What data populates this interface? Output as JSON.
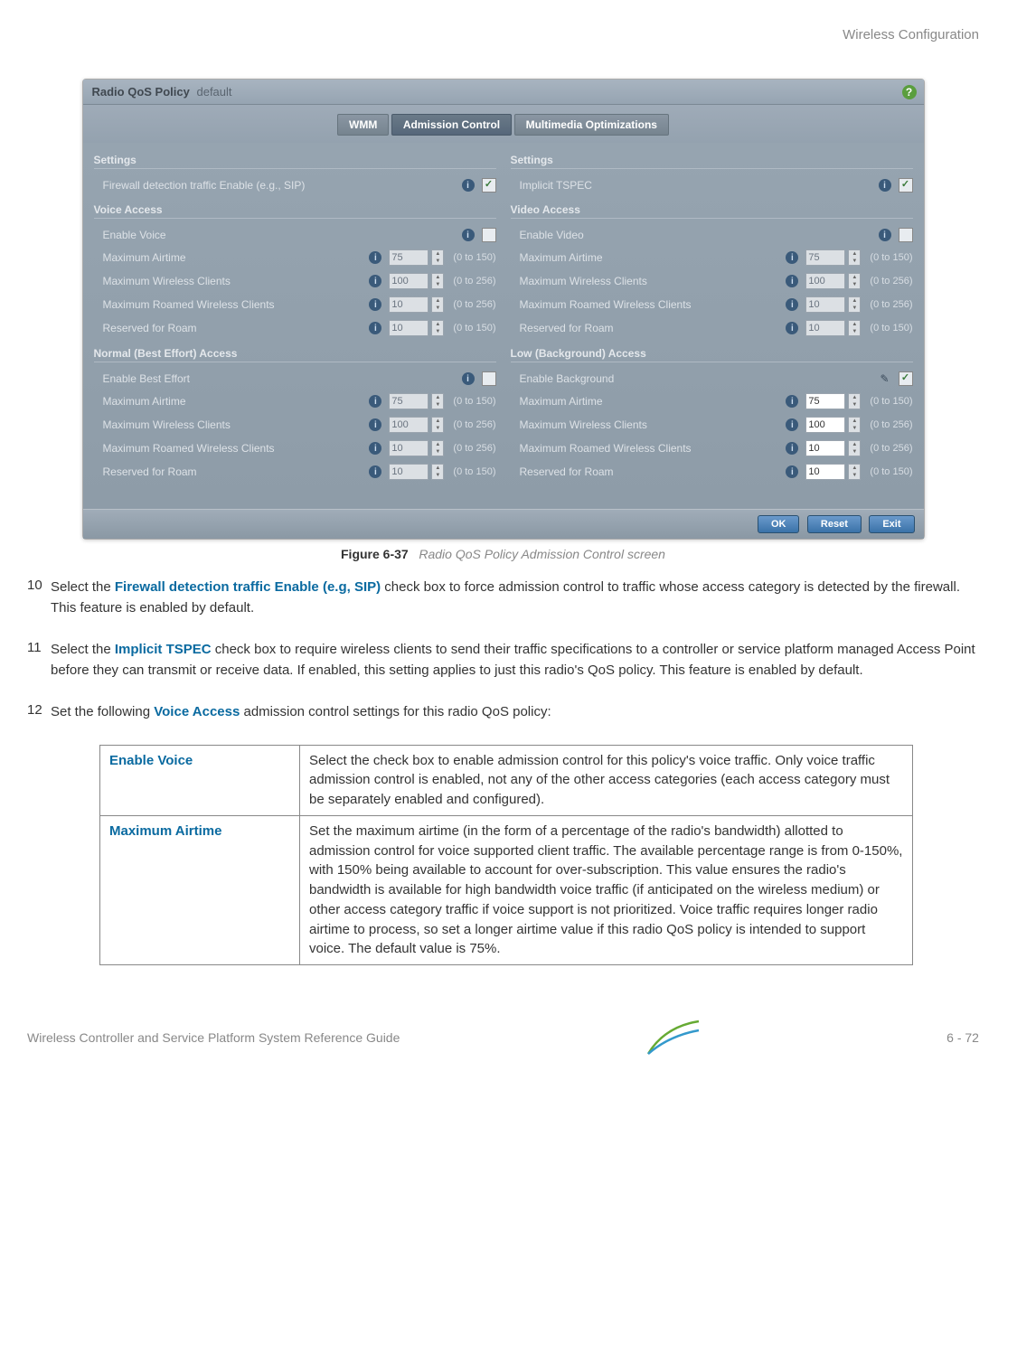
{
  "header_right": "Wireless Configuration",
  "screenshot": {
    "title_prefix": "Radio QoS Policy",
    "title_suffix": "default",
    "help": "?",
    "tabs": {
      "wmm": "WMM",
      "admission": "Admission Control",
      "multimedia": "Multimedia Optimizations"
    },
    "left": {
      "settings_title": "Settings",
      "firewall_label": "Firewall detection traffic Enable (e.g., SIP)",
      "firewall_checked": "✓",
      "voice_title": "Voice Access",
      "voice": {
        "enable_label": "Enable Voice",
        "airtime_label": "Maximum Airtime",
        "airtime_val": "75",
        "airtime_range": "(0 to 150)",
        "clients_label": "Maximum Wireless Clients",
        "clients_val": "100",
        "clients_range": "(0 to 256)",
        "roamed_label": "Maximum Roamed Wireless Clients",
        "roamed_val": "10",
        "roamed_range": "(0 to 256)",
        "reserved_label": "Reserved for Roam",
        "reserved_val": "10",
        "reserved_range": "(0 to 150)"
      },
      "be_title": "Normal (Best Effort) Access",
      "be": {
        "enable_label": "Enable Best Effort",
        "airtime_label": "Maximum Airtime",
        "airtime_val": "75",
        "airtime_range": "(0 to 150)",
        "clients_label": "Maximum Wireless Clients",
        "clients_val": "100",
        "clients_range": "(0 to 256)",
        "roamed_label": "Maximum Roamed Wireless Clients",
        "roamed_val": "10",
        "roamed_range": "(0 to 256)",
        "reserved_label": "Reserved for Roam",
        "reserved_val": "10",
        "reserved_range": "(0 to 150)"
      }
    },
    "right": {
      "settings_title": "Settings",
      "tspec_label": "Implicit TSPEC",
      "tspec_checked": "✓",
      "video_title": "Video Access",
      "video": {
        "enable_label": "Enable Video",
        "airtime_label": "Maximum Airtime",
        "airtime_val": "75",
        "airtime_range": "(0 to 150)",
        "clients_label": "Maximum Wireless Clients",
        "clients_val": "100",
        "clients_range": "(0 to 256)",
        "roamed_label": "Maximum Roamed Wireless Clients",
        "roamed_val": "10",
        "roamed_range": "(0 to 256)",
        "reserved_label": "Reserved for Roam",
        "reserved_val": "10",
        "reserved_range": "(0 to 150)"
      },
      "bg_title": "Low (Background) Access",
      "bg": {
        "enable_label": "Enable Background",
        "enable_checked": "✓",
        "airtime_label": "Maximum Airtime",
        "airtime_val": "75",
        "airtime_range": "(0 to 150)",
        "clients_label": "Maximum Wireless Clients",
        "clients_val": "100",
        "clients_range": "(0 to 256)",
        "roamed_label": "Maximum Roamed Wireless Clients",
        "roamed_val": "10",
        "roamed_range": "(0 to 256)",
        "reserved_label": "Reserved for Roam",
        "reserved_val": "10",
        "reserved_range": "(0 to 150)"
      }
    },
    "buttons": {
      "ok": "OK",
      "reset": "Reset",
      "exit": "Exit"
    }
  },
  "caption_bold": "Figure 6-37",
  "caption_rest": "Radio QoS Policy Admission Control screen",
  "step10": {
    "num": "10",
    "pre": "Select the ",
    "hl": "Firewall detection traffic Enable (e.g, SIP)",
    "post": " check box to force admission control to traffic whose access category is detected by the firewall. This feature is enabled by default."
  },
  "step11": {
    "num": "11",
    "pre": "Select the ",
    "hl": "Implicit TSPEC",
    "post": " check box to require wireless clients to send their traffic specifications to a controller or service platform managed Access Point before they can transmit or receive data. If enabled, this setting applies to just this radio's QoS policy. This feature is enabled by default."
  },
  "step12": {
    "num": "12",
    "pre": "Set the following ",
    "hl": "Voice Access",
    "post": " admission control settings for this radio QoS policy:"
  },
  "table": {
    "row1_label": "Enable Voice",
    "row1_desc": "Select the check box to enable admission control for this policy's voice traffic. Only voice traffic admission control is enabled, not any of the other access categories (each access category must be separately enabled and configured).",
    "row2_label": "Maximum Airtime",
    "row2_desc": "Set the maximum airtime (in the form of a percentage of the radio's bandwidth) allotted to admission control for voice supported client traffic. The available percentage range is from 0-150%, with 150% being available to account for over-subscription. This value ensures the radio's bandwidth is available for high bandwidth voice traffic (if anticipated on the wireless medium) or other access category traffic if voice support is not prioritized. Voice traffic requires longer radio airtime to process, so set a longer airtime value if this radio QoS policy is intended to support voice. The default value is 75%."
  },
  "footer_left": "Wireless Controller and Service Platform System Reference Guide",
  "footer_right": "6 - 72"
}
